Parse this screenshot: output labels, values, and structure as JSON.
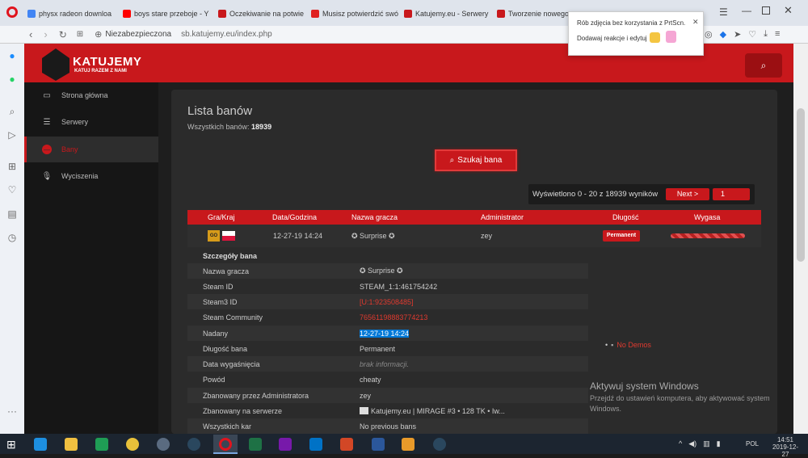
{
  "browser": {
    "tabs": [
      {
        "label": "physx radeon downloa",
        "favcolor": "#4285f4"
      },
      {
        "label": "boys stare przeboje - Y",
        "favcolor": "#ff0000"
      },
      {
        "label": "Oczekiwanie na potwie",
        "favcolor": "#c8181c"
      },
      {
        "label": "Musisz potwierdzić swó",
        "favcolor": "#e02020"
      },
      {
        "label": "Katujemy.eu - Serwery",
        "favcolor": "#c8181c"
      },
      {
        "label": "Tworzenie nowego te",
        "favcolor": "#c8181c"
      }
    ],
    "security_label": "Niezabezpieczona",
    "url": "sb.katujemy.eu/index.php",
    "popup": {
      "line1": "Rób zdjęcia bez korzystania z PrtScn.",
      "line2": "Dodawaj reakcje i edytuj"
    }
  },
  "site": {
    "logo_name": "KATUJEMY",
    "logo_tagline": "KATUJ RAZEM Z NAMI",
    "nav": [
      {
        "label": "Strona główna",
        "icon": "monitor-icon"
      },
      {
        "label": "Serwery",
        "icon": "server-icon"
      },
      {
        "label": "Bany",
        "icon": "ban-icon"
      },
      {
        "label": "Wyciszenia",
        "icon": "mute-icon"
      }
    ]
  },
  "main": {
    "title": "Lista banów",
    "total_label": "Wszystkich banów:",
    "total_value": "18939",
    "search_button": "Szukaj bana",
    "pagination_text": "Wyświetlono 0 - 20 z 18939 wyników",
    "next_button": "Next >",
    "page_value": "1",
    "columns": [
      "Gra/Kraj",
      "Data/Godzina",
      "Nazwa gracza",
      "Administrator",
      "Długość",
      "Wygasa"
    ],
    "row": {
      "game_badge": "GO",
      "date": "12-27-19 14:24",
      "player": "✪ Surprise ✪",
      "admin": "zey",
      "length": "Permanent"
    },
    "details_title": "Szczegóły bana",
    "details": [
      {
        "key": "Nazwa gracza",
        "value": "✪ Surprise ✪"
      },
      {
        "key": "Steam ID",
        "value": "STEAM_1:1:461754242"
      },
      {
        "key": "Steam3 ID",
        "value": "[U:1:923508485]"
      },
      {
        "key": "Steam Community",
        "value": "76561198883774213"
      },
      {
        "key": "Nadany",
        "value": "12-27-19 14:24"
      },
      {
        "key": "Długość bana",
        "value": "Permanent"
      },
      {
        "key": "Data wygaśnięcia",
        "value": "brak informacji."
      },
      {
        "key": "Powód",
        "value": "cheaty"
      },
      {
        "key": "Zbanowany przez Administratora",
        "value": "zey"
      },
      {
        "key": "Zbanowany na serwerze",
        "value": "Katujemy.eu | MIRAGE #3 • 128 TK • Iw..."
      },
      {
        "key": "Wszystkich kar",
        "value": "No previous bans"
      }
    ],
    "demos": "No Demos"
  },
  "windows": {
    "activate_title": "Aktywuj system Windows",
    "activate_line1": "Przejdź do ustawień komputera, aby aktywować system",
    "activate_line2": "Windows.",
    "time": "14:51",
    "date": "2019-12-27",
    "lang": "POL"
  },
  "colors": {
    "accent": "#c8181c",
    "link_red": "#e03a2f",
    "selection": "#0078d7"
  }
}
